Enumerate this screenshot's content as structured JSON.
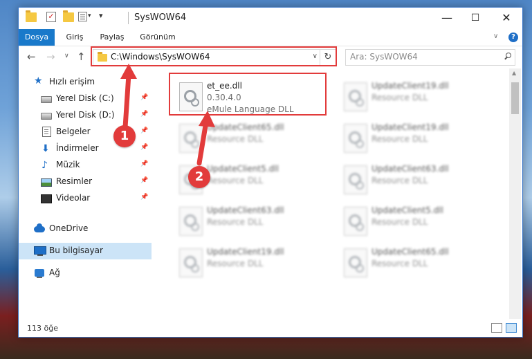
{
  "window": {
    "title": "SysWOW64",
    "controls": {
      "minimize": "—",
      "maximize": "☐",
      "close": "✕"
    }
  },
  "quick_access_toolbar": {
    "icons": [
      "folder-icon",
      "properties-check-icon",
      "folder-icon",
      "properties-icon",
      "dropdown-icon"
    ]
  },
  "ribbon": {
    "tabs": [
      {
        "label": "Dosya",
        "active": true
      },
      {
        "label": "Giriş",
        "active": false
      },
      {
        "label": "Paylaş",
        "active": false
      },
      {
        "label": "Görünüm",
        "active": false
      }
    ],
    "help_label": "?"
  },
  "navigation": {
    "address": "C:\\Windows\\SysWOW64",
    "search_placeholder": "Ara: SysWOW64"
  },
  "sidebar": {
    "items": [
      {
        "label": "Hızlı erişim",
        "icon": "star-icon",
        "pinned": false
      },
      {
        "label": "Yerel Disk (C:)",
        "icon": "disk-icon",
        "pinned": true
      },
      {
        "label": "Yerel Disk (D:)",
        "icon": "disk-icon",
        "pinned": true
      },
      {
        "label": "Belgeler",
        "icon": "documents-icon",
        "pinned": true
      },
      {
        "label": "İndirmeler",
        "icon": "download-icon",
        "pinned": true
      },
      {
        "label": "Müzik",
        "icon": "music-icon",
        "pinned": true
      },
      {
        "label": "Resimler",
        "icon": "pictures-icon",
        "pinned": true
      },
      {
        "label": "Videolar",
        "icon": "videos-icon",
        "pinned": true
      },
      {
        "label": "OneDrive",
        "icon": "cloud-icon",
        "pinned": false
      },
      {
        "label": "Bu bilgisayar",
        "icon": "computer-icon",
        "pinned": false,
        "selected": true
      },
      {
        "label": "Ağ",
        "icon": "network-icon",
        "pinned": false
      }
    ]
  },
  "files": [
    {
      "name": "et_ee.dll",
      "meta": "0.30.4.0",
      "desc": "eMule Language DLL",
      "focused": true
    },
    {
      "name": "UpdateClient19.dll",
      "desc": "Resource DLL"
    },
    {
      "name": "UpdateClient65.dll",
      "desc": "Resource DLL"
    },
    {
      "name": "UpdateClient19.dll",
      "desc": "Resource DLL"
    },
    {
      "name": "UpdateClient5.dll",
      "desc": "Resource DLL"
    },
    {
      "name": "UpdateClient63.dll",
      "desc": "Resource DLL"
    },
    {
      "name": "UpdateClient63.dll",
      "desc": "Resource DLL"
    },
    {
      "name": "UpdateClient5.dll",
      "desc": "Resource DLL"
    },
    {
      "name": "UpdateClient19.dll",
      "desc": "Resource DLL"
    },
    {
      "name": "UpdateClient65.dll",
      "desc": "Resource DLL"
    }
  ],
  "status": {
    "count": "113 öğe"
  },
  "annotations": {
    "callouts": [
      "1",
      "2"
    ],
    "highlight_color": "#e23b3b"
  },
  "colors": {
    "accent": "#1979ca",
    "selected_bg": "#cce4f7"
  }
}
